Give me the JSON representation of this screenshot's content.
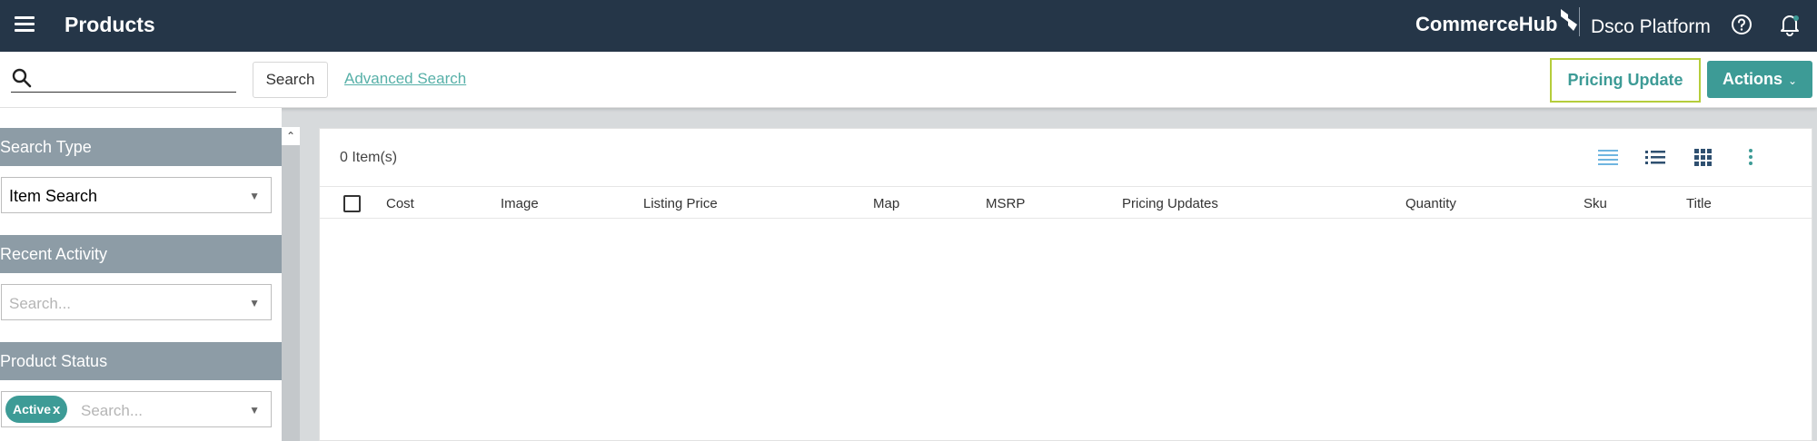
{
  "header": {
    "title": "Products",
    "brand": "CommerceHub",
    "platform": "Dsco Platform"
  },
  "toolbar": {
    "search_placeholder": "",
    "search_label": "Search",
    "advanced_search": "Advanced Search",
    "pricing_update": "Pricing Update",
    "actions": "Actions"
  },
  "sidebar": {
    "search_type": {
      "title": "Search Type",
      "value": "Item Search"
    },
    "recent_activity": {
      "title": "Recent Activity",
      "placeholder": "Search..."
    },
    "product_status": {
      "title": "Product Status",
      "chip": "Active",
      "chip_remove": "x",
      "placeholder": "Search..."
    }
  },
  "main": {
    "count": "0 Item(s)",
    "columns": [
      "Cost",
      "Image",
      "Listing Price",
      "Map",
      "MSRP",
      "Pricing Updates",
      "Quantity",
      "Sku",
      "Title"
    ]
  },
  "colors": {
    "nav": "#253648",
    "accent": "#3d9b96",
    "highlight": "#b5cd3b",
    "sidebar_header": "#8d9ca6",
    "active_view": "#6fb5e0"
  }
}
